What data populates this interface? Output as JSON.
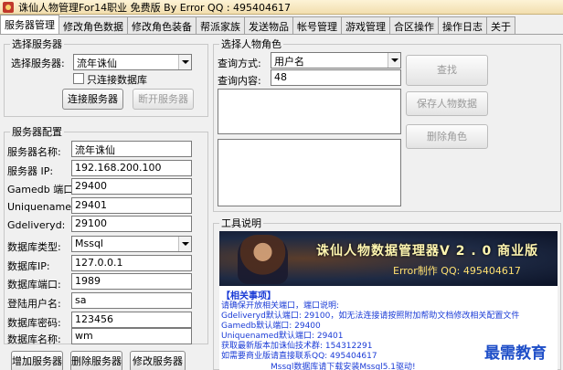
{
  "window": {
    "title": "诛仙人物管理For14职业 免费版 By Error QQ : 495404617"
  },
  "tabs": [
    "服务器管理",
    "修改角色数据",
    "修改角色装备",
    "帮派家族",
    "发送物品",
    "帐号管理",
    "游戏管理",
    "合区操作",
    "操作日志",
    "关于"
  ],
  "select_server": {
    "legend": "选择服务器",
    "label": "选择服务器:",
    "value": "流年诛仙",
    "only_db_label": "只连接数据库",
    "connect_button": "连接服务器",
    "disconnect_button": "断开服务器"
  },
  "server_config": {
    "legend": "服务器配置",
    "fields": [
      {
        "label": "服务器名称:",
        "value": "流年诛仙"
      },
      {
        "label": "服务器 IP:",
        "value": "192.168.200.100"
      },
      {
        "label": "Gamedb 端口:",
        "value": "29400"
      },
      {
        "label": "Uniquenamed:",
        "value": "29401"
      },
      {
        "label": "Gdeliveryd:",
        "value": "29100"
      },
      {
        "label": "数据库类型:",
        "value": "Mssql"
      },
      {
        "label": "数据库IP:",
        "value": "127.0.0.1"
      },
      {
        "label": "数据库端口:",
        "value": "1989"
      },
      {
        "label": "登陆用户名:",
        "value": "sa"
      },
      {
        "label": "数据库密码:",
        "value": "123456"
      },
      {
        "label": "数据库名称:",
        "value": "wm"
      }
    ],
    "add_button": "增加服务器",
    "delete_button": "删除服务器",
    "modify_button": "修改服务器"
  },
  "select_role": {
    "legend": "选择人物角色",
    "method_label": "查询方式:",
    "method_value": "用户名",
    "content_label": "查询内容:",
    "content_value": "48",
    "find_button": "查找",
    "save_button": "保存人物数据",
    "delete_button": "删除角色"
  },
  "tool_info": {
    "legend": "工具说明",
    "banner_title": "诛仙人物数据管理器V 2 . 0 商业版",
    "banner_sub": "Error制作 QQ: 495404617",
    "notes": [
      "【相关事项】",
      "请确保开放相关端口，端口说明:",
      "Gdeliveryd默认端口: 29100，如无法连接请按照附加帮助文档修改相关配置文件",
      "Gamedb默认端口: 29400",
      "Uniquenamed默认端口: 29401",
      "获取最新版本加诛仙技术群: 154312291",
      "如需要商业版请直接联系QQ: 495404617",
      "Mssql数据库请下载安装Mssql5.1驱动!"
    ],
    "watermark": "最需教育"
  }
}
